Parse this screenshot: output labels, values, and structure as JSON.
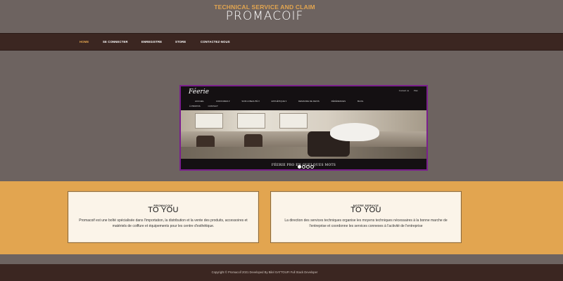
{
  "header": {
    "tagline": "TECHNICAL SERVICE AND CLAIM",
    "brand": "PROMACOIF"
  },
  "nav": {
    "items": [
      {
        "label": "HOME",
        "active": true
      },
      {
        "label": "SE CONNECTER",
        "active": false
      },
      {
        "label": "ENREGISTRE",
        "active": false
      },
      {
        "label": "STORE",
        "active": false
      },
      {
        "label": "CONTACTEZ-NOUS",
        "active": false
      }
    ]
  },
  "hero": {
    "logo": "Féerie",
    "toplinks": [
      "Contact us",
      "Plan"
    ],
    "menu_row1": [
      "ACCUEIL",
      "COIFFURES ▾",
      "SOIN & BEAUTÉ ▾",
      "ESTHÉTIQUE ▾",
      "DEMANDE DE DEVIS",
      "RÉFÉRENCES",
      "BLOG"
    ],
    "menu_row2": [
      "À PROPOS",
      "CONTACT"
    ],
    "caption": "FÉERIE PRO EN QUELQUES MOTS",
    "slides": 4,
    "active_slide": 1
  },
  "features": [
    {
      "kicker": "PROMACOIF",
      "title": "TO YOU",
      "body": "Promacoif est une boîté spécialisée dans l'importation, la distribution et la vente des produits, accessoires et matériels de coiffure et équipements pour les centre d'esthétique."
    },
    {
      "kicker": "NOTRE SERVICE",
      "title": "TO YOU",
      "body": "La direction des services techniques organise les moyens techniques nécessaires à la bonne marche de l'entreprise et coordonne les services connexes à l'activité de l'entreprise"
    }
  ],
  "footer": {
    "copyright": "Copyright © Promacoif 2021 Developed By Bilel GATTOUFI Full Stack Developer"
  },
  "colors": {
    "page_bg": "#6d6360",
    "nav_bg": "#3b2621",
    "accent": "#e2a550",
    "hero_border": "#7a1f8c",
    "card_bg": "#fbf4e9"
  }
}
